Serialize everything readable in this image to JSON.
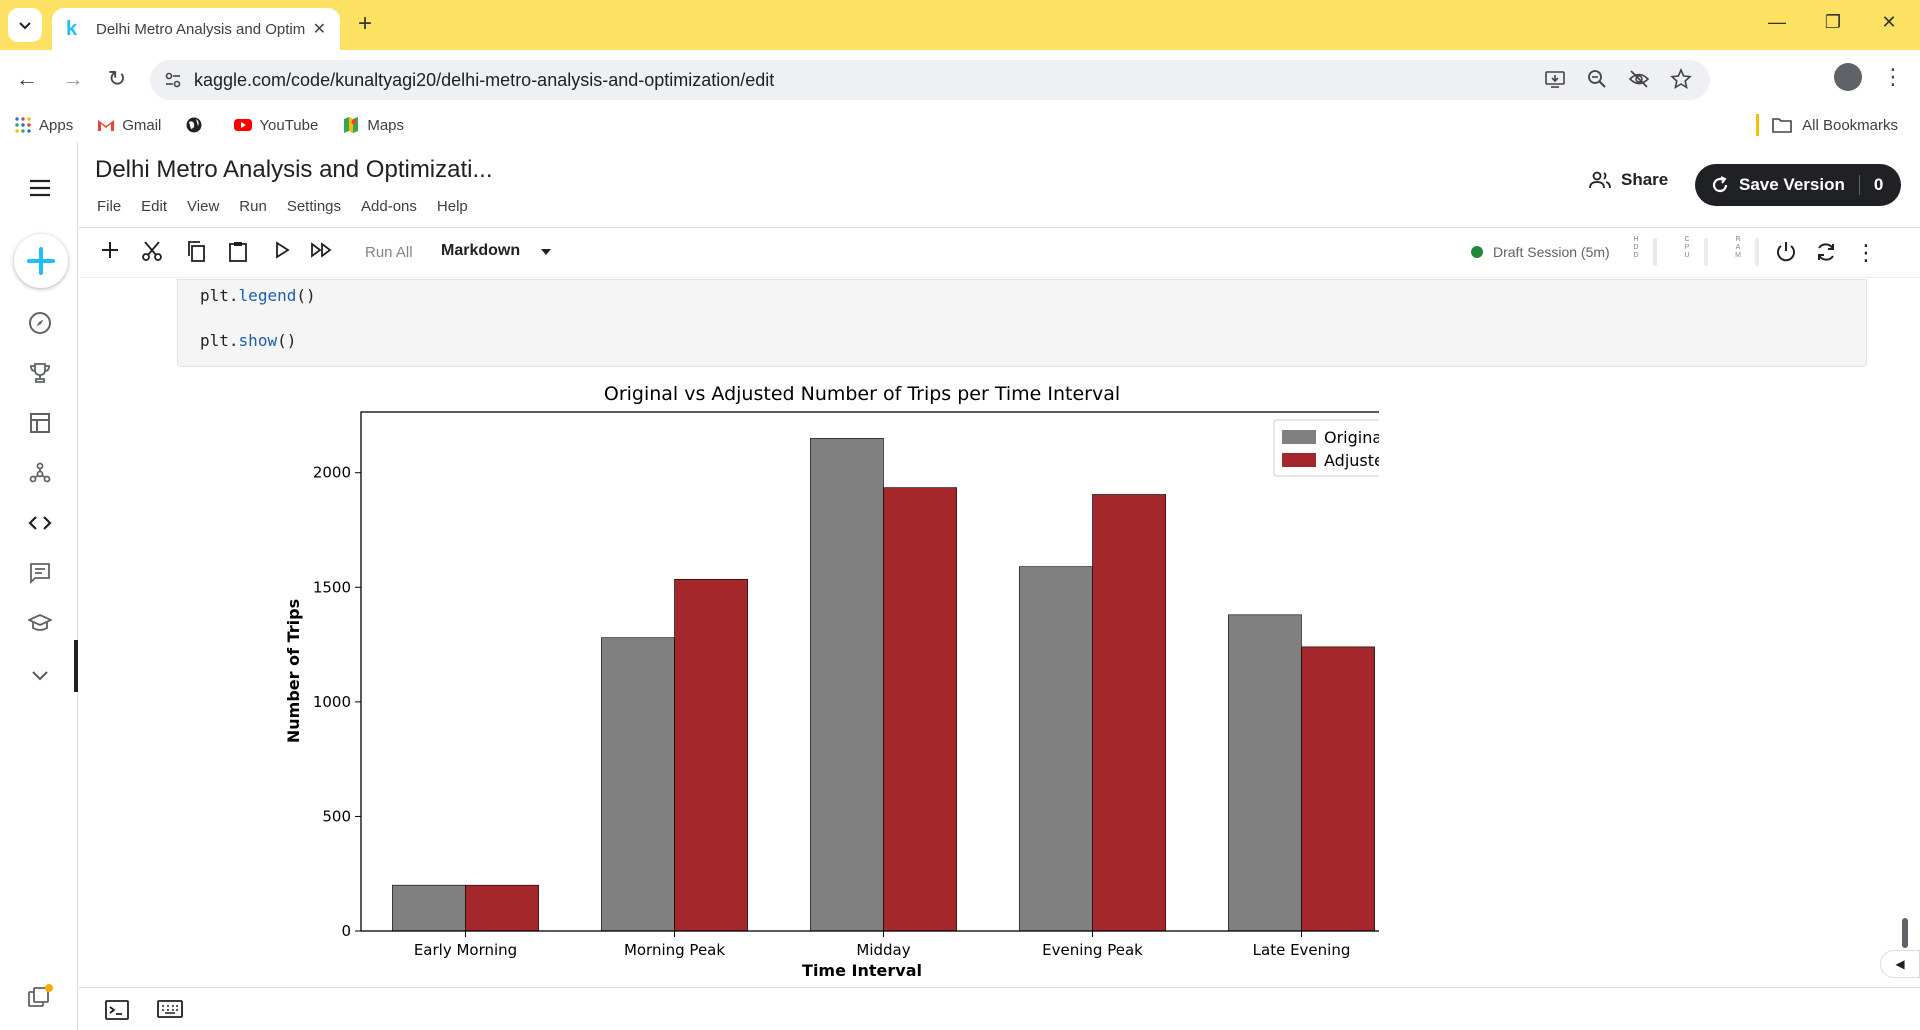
{
  "browser": {
    "tab_title": "Delhi Metro Analysis and Optim",
    "url": "kaggle.com/code/kunaltyagi20/delhi-metro-analysis-and-optimization/edit",
    "bookmarks": [
      "Apps",
      "Gmail",
      "YouTube",
      "Maps"
    ],
    "all_bookmarks": "All Bookmarks"
  },
  "notebook": {
    "title": "Delhi Metro Analysis and Optimizati...",
    "menu": [
      "File",
      "Edit",
      "View",
      "Run",
      "Settings",
      "Add-ons",
      "Help"
    ],
    "share_label": "Share",
    "save_label": "Save Version",
    "save_count": "0",
    "run_all": "Run All",
    "cell_type": "Markdown",
    "session": "Draft Session (5m)",
    "resources": [
      "HDD",
      "CPU",
      "RAM"
    ],
    "code_lines": [
      {
        "obj": "plt",
        "fn": "legend",
        "args": "()"
      },
      {
        "obj": "plt",
        "fn": "show",
        "args": "()"
      }
    ]
  },
  "chart_data": {
    "type": "bar",
    "title": "Original vs Adjusted Number of Trips per Time Interval",
    "xlabel": "Time Interval",
    "ylabel": "Number of Trips",
    "categories": [
      "Early Morning",
      "Morning Peak",
      "Midday",
      "Evening Peak",
      "Late Evening"
    ],
    "series": [
      {
        "name": "Original",
        "color": "#808080",
        "values": [
          200,
          1280,
          2150,
          1590,
          1380
        ]
      },
      {
        "name": "Adjusted",
        "color": "#a4282b",
        "values": [
          200,
          1535,
          1935,
          1905,
          1240
        ]
      }
    ],
    "ylim": [
      0,
      2265
    ],
    "yticks": [
      0,
      500,
      1000,
      1500,
      2000
    ],
    "legend": "top-right"
  }
}
